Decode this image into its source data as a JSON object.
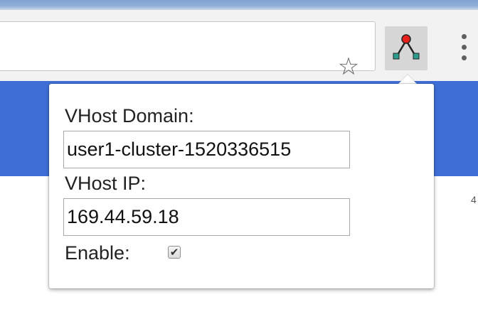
{
  "browser": {
    "toolbar": {
      "bookmark_icon": "star-outline",
      "bookmark_glyph": "☆",
      "extension_icon": "network-graph",
      "menu_icon": "vertical-dots"
    },
    "page": {
      "band_color": "#3f6fd6",
      "edge_glyph": "4"
    }
  },
  "popup": {
    "domain_label": "VHost Domain:",
    "domain_value": "user1-cluster-1520336515",
    "ip_label": "VHost IP:",
    "ip_value": "169.44.59.18",
    "enable_label": "Enable:",
    "enable_checked": true,
    "check_glyph": "✔"
  },
  "colors": {
    "band": "#3f6fd6",
    "node_red": "#e8201a",
    "node_teal": "#2a9d8f"
  }
}
